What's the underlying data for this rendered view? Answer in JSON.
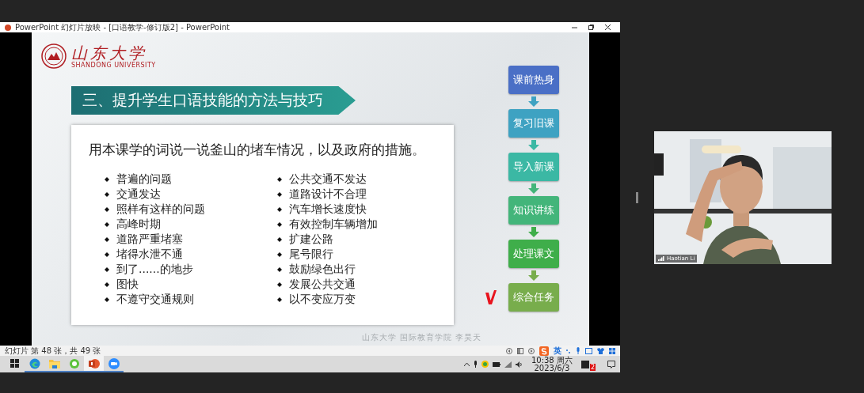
{
  "window": {
    "title": "PowerPoint 幻灯片放映 - [口语教学-修订版2] - PowerPoint"
  },
  "slide": {
    "logo": {
      "name": "山东大学",
      "subtitle": "SHANDONG UNIVERSITY"
    },
    "heading": "三、提升学生口语技能的方法与技巧",
    "prompt": "用本课学的词说一说釜山的堵车情况，以及政府的措施。",
    "columns": [
      [
        "普遍的问题",
        "交通发达",
        "照样有这样的问题",
        "高峰时期",
        "道路严重堵塞",
        "堵得水泄不通",
        "到了......的地步",
        "图快",
        "不遵守交通规则"
      ],
      [
        "公共交通不发达",
        "道路设计不合理",
        "汽车增长速度快",
        "有效控制车辆增加",
        "扩建公路",
        "尾号限行",
        "鼓励绿色出行",
        "发展公共交通",
        "以不变应万变"
      ]
    ],
    "steps": [
      {
        "label": "课前热身",
        "color": "#4a6fc6",
        "selected": false
      },
      {
        "label": "复习旧课",
        "color": "#3ea2c2",
        "selected": false
      },
      {
        "label": "导入新课",
        "color": "#3bb8a4",
        "selected": false
      },
      {
        "label": "知识讲练",
        "color": "#43b57a",
        "selected": false
      },
      {
        "label": "处理课文",
        "color": "#3fae4a",
        "selected": false
      },
      {
        "label": "综合任务",
        "color": "#78ad4c",
        "selected": true
      }
    ],
    "footer": "山东大学 国际教育学院 李昊天"
  },
  "status_bar": {
    "slide_counter": "幻灯片 第 48 张，共 49 张",
    "ime": "英"
  },
  "taskbar": {
    "apps": [
      {
        "kind": "windows",
        "selected": false
      },
      {
        "kind": "edge",
        "selected": false
      },
      {
        "kind": "folder",
        "selected": false
      },
      {
        "kind": "green",
        "selected": false
      },
      {
        "kind": "powerpoint",
        "selected": true
      },
      {
        "kind": "zoom",
        "selected": false
      }
    ],
    "time": "10:38 周六",
    "date": "2023/6/3",
    "notifications": "2"
  },
  "video": {
    "participant": "Haotian Li"
  }
}
